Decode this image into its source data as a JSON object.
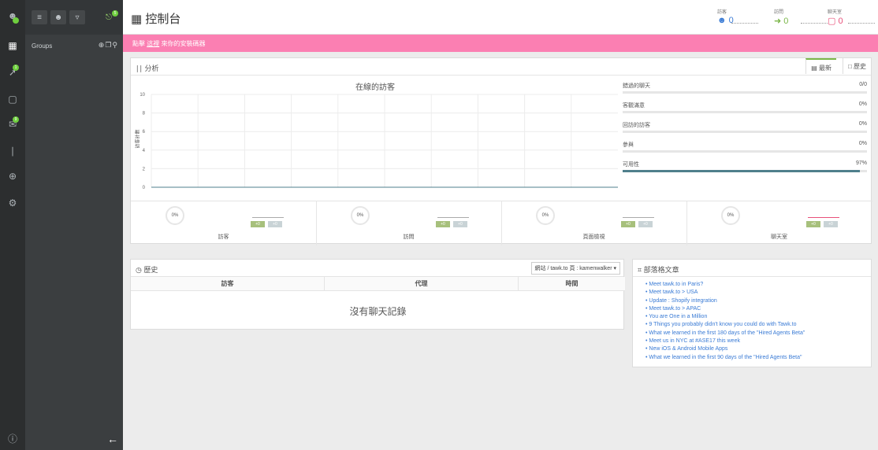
{
  "header": {
    "title": "控制台"
  },
  "stats": [
    {
      "label": "訪客",
      "value": "0",
      "color": "#3a7bd5"
    },
    {
      "label": "訪問",
      "value": "0",
      "color": "#7ab648"
    },
    {
      "label": "聊天室",
      "value": "0",
      "color": "#e8507a"
    }
  ],
  "banner": {
    "prefix": "點擊",
    "link": "這裡",
    "suffix": "來你的安裝碼器"
  },
  "sidebar": {
    "groups_label": "Groups",
    "badge1": "1",
    "badge2": "9",
    "badge3": "5"
  },
  "analytics": {
    "title": "分析",
    "tabs": [
      "最新",
      "歷史"
    ],
    "chart_title": "在線的訪客",
    "ylabel": "訪客計數",
    "metrics": [
      {
        "label": "錯過的聊天",
        "value": "0/0",
        "fill": 0
      },
      {
        "label": "客觀滿意",
        "value": "0%",
        "fill": 0
      },
      {
        "label": "回訪的訪客",
        "value": "0%",
        "fill": 0
      },
      {
        "label": "參與",
        "value": "0%",
        "fill": 0
      },
      {
        "label": "可用性",
        "value": "97%",
        "fill": 0.97
      }
    ],
    "tiles": [
      {
        "pct": "0%",
        "label": "訪客",
        "a": "+0",
        "b": "+0"
      },
      {
        "pct": "0%",
        "label": "訪問",
        "a": "+0",
        "b": "+0"
      },
      {
        "pct": "0%",
        "label": "頁面檢視",
        "a": "+0",
        "b": "+0"
      },
      {
        "pct": "0%",
        "label": "聊天室",
        "a": "+0",
        "b": "+0"
      }
    ]
  },
  "chart_data": {
    "type": "line",
    "title": "在線的訪客",
    "ylabel": "訪客計數",
    "ylim": [
      0,
      10
    ],
    "yticks": [
      "10",
      "8",
      "6",
      "4",
      "2",
      "0"
    ],
    "series": [
      {
        "values": [
          0,
          0,
          0,
          0,
          0,
          0,
          0,
          0,
          0,
          0,
          0,
          0,
          0,
          0,
          0,
          0,
          0,
          0,
          0,
          0,
          0
        ]
      }
    ],
    "grid": true
  },
  "history": {
    "title": "歷史",
    "filter": "網站 / tawk.to 頁 : kamenwalker ▾",
    "columns": [
      "訪客",
      "代理",
      "時間"
    ],
    "empty": "沒有聊天記錄"
  },
  "blog": {
    "title": "部落格文章",
    "items": [
      "Meet tawk.to in Paris?",
      "Meet tawk.to > USA",
      "Update : Shopify integration",
      "Meet tawk.to > APAC",
      "You are One in a Million",
      "9 Things you probably didn't know you could do with Tawk.to",
      "What we learned in the first 180 days of the \"Hired Agents Beta\"",
      "Meet us in NYC at #ASE17 this week",
      "New iOS & Android Mobile Apps",
      "What we learned in the first 90 days of the \"Hired Agents Beta\""
    ]
  }
}
